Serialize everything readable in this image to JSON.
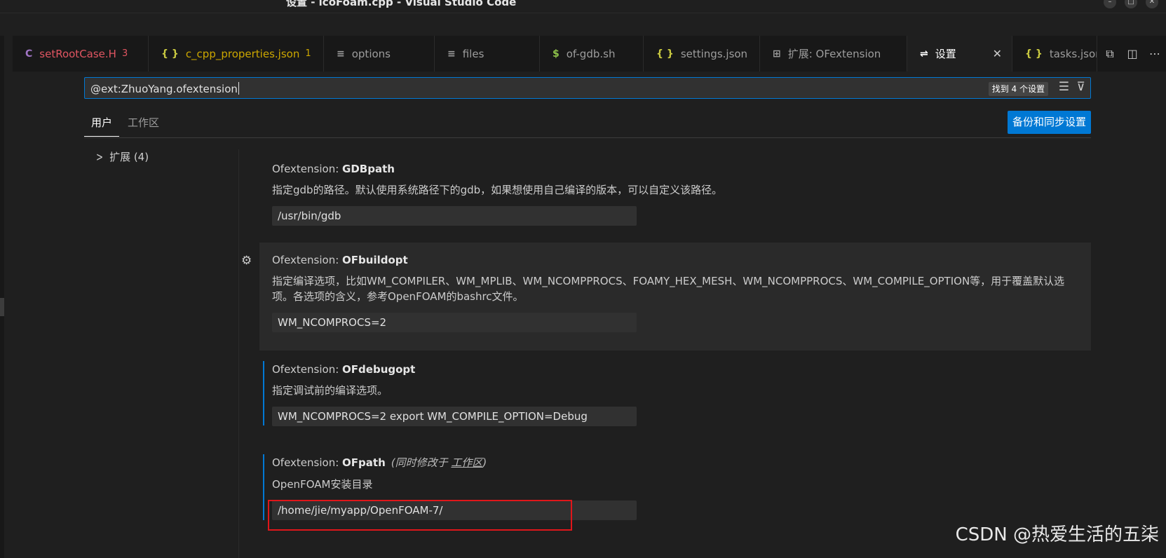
{
  "window": {
    "title": "设置 - icoFoam.cpp - Visual Studio Code"
  },
  "tabs": [
    {
      "label": "setRootCase.H",
      "badge": "3",
      "icon": "C",
      "color": "#e05561",
      "iconColor": "#a074c4"
    },
    {
      "label": "c_cpp_properties.json",
      "badge": "1",
      "icon": "{ }",
      "color": "#cca700",
      "iconColor": "#cbcb41"
    },
    {
      "label": "options",
      "badge": "",
      "icon": "≡",
      "color": "#9d9d9d",
      "iconColor": "#9d9d9d"
    },
    {
      "label": "files",
      "badge": "",
      "icon": "≡",
      "color": "#9d9d9d",
      "iconColor": "#9d9d9d"
    },
    {
      "label": "of-gdb.sh",
      "badge": "",
      "icon": "$",
      "color": "#9d9d9d",
      "iconColor": "#8dc149"
    },
    {
      "label": "settings.json",
      "badge": "",
      "icon": "{ }",
      "color": "#9d9d9d",
      "iconColor": "#cbcb41"
    },
    {
      "label": "扩展: OFextension",
      "badge": "",
      "icon": "⊞",
      "color": "#9d9d9d",
      "iconColor": "#9d9d9d"
    },
    {
      "label": "设置",
      "badge": "",
      "icon": "⇌",
      "color": "#ffffff",
      "iconColor": "#cccccc"
    },
    {
      "label": "tasks.json",
      "badge": "",
      "icon": "{ }",
      "color": "#9d9d9d",
      "iconColor": "#cbcb41"
    }
  ],
  "search": {
    "query": "@ext:ZhuoYang.ofextension",
    "result_count": "找到 4 个设置"
  },
  "scopes": {
    "user": "用户",
    "workspace": "工作区",
    "sync_button": "备份和同步设置"
  },
  "toc": {
    "item_label": "扩展 (4)"
  },
  "settings": [
    {
      "category": "Ofextension: ",
      "name": "GDBpath",
      "description": "指定gdb的路径。默认使用系统路径下的gdb，如果想使用自己编译的版本，可以自定义该路径。",
      "value": "/usr/bin/gdb"
    },
    {
      "category": "Ofextension: ",
      "name": "OFbuildopt",
      "description": "指定编译选项，比如WM_COMPILER、WM_MPLIB、WM_NCOMPPROCS、FOAMY_HEX_MESH、WM_NCOMPPROCS、WM_COMPILE_OPTION等，用于覆盖默认选项。各选项的含义，参考OpenFOAM的bashrc文件。",
      "value": "WM_NCOMPROCS=2"
    },
    {
      "category": "Ofextension: ",
      "name": "OFdebugopt",
      "description": "指定调试前的编译选项。",
      "value": "WM_NCOMPROCS=2 export WM_COMPILE_OPTION=Debug"
    },
    {
      "category": "Ofextension: ",
      "name": "OFpath",
      "scope_note_prefix": "(同时修改于 ",
      "scope_note_link": "工作区",
      "scope_note_suffix": ")",
      "description": "OpenFOAM安装目录",
      "value": "/home/jie/myapp/OpenFOAM-7/"
    }
  ],
  "watermark": "CSDN @热爱生活的五柒",
  "colors": {
    "accent": "#0078d4",
    "highlight": "#e0161a"
  }
}
